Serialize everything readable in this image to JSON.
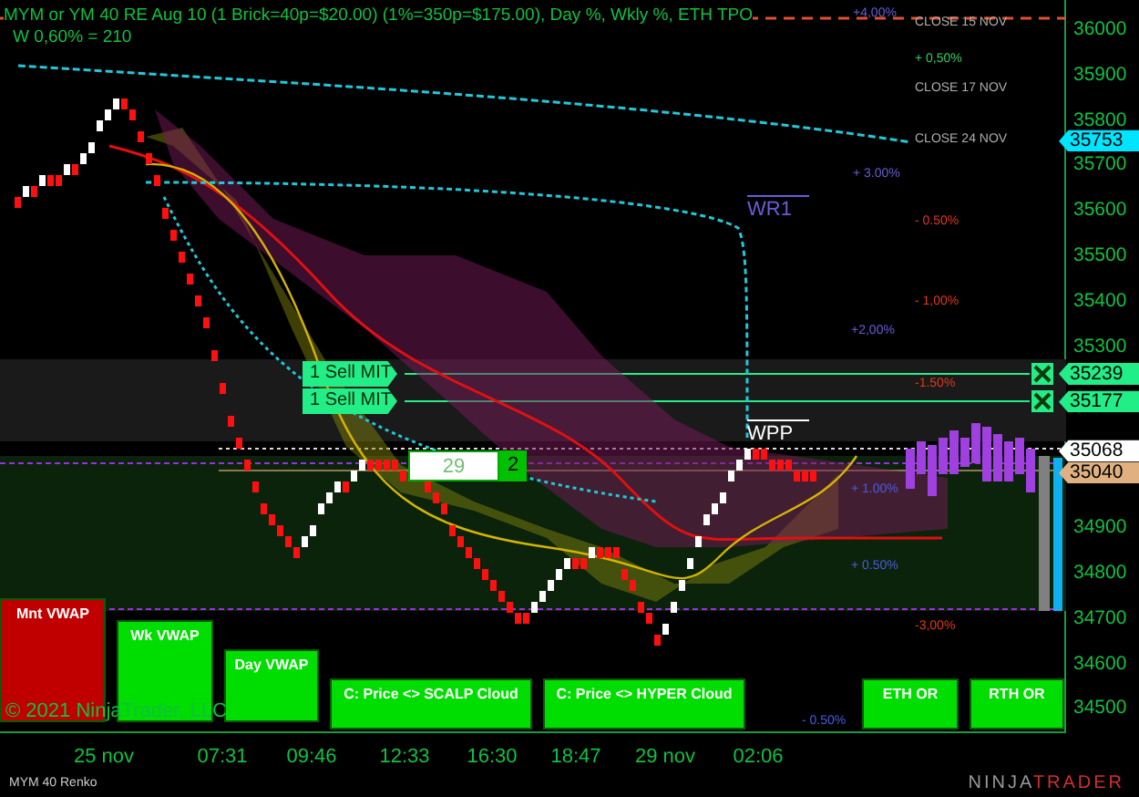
{
  "chart": {
    "title": "MYM or YM 40 RE Aug 10 (1 Brick=40p=$20.00) (1%=350p=$175.00), Day %, Wkly %, ETH TPO",
    "subtitle": "W 0,60% = 210",
    "copyright": "© 2021 NinjaTrader, LLC",
    "instrument": "MYM 40 Renko",
    "logo": [
      "NINJA",
      "TRADER"
    ]
  },
  "level_labels": [
    {
      "text": "+4,00%",
      "color": "#6a5cd8"
    },
    {
      "text": "CLOSE 15 NOV",
      "color": "#b0b0b0"
    },
    {
      "text": "+ 0,50%",
      "color": "#30d060"
    },
    {
      "text": "CLOSE 17 NOV",
      "color": "#b0b0b0"
    },
    {
      "text": "CLOSE 24 NOV",
      "color": "#b0b0b0"
    },
    {
      "text": "+ 3.00%",
      "color": "#6a5cd8"
    },
    {
      "text": "- 0.50%",
      "color": "#e03a1a"
    },
    {
      "text": "- 1,00%",
      "color": "#e03a1a"
    },
    {
      "text": "+2,00%",
      "color": "#6a5cd8"
    },
    {
      "text": "-1.50%",
      "color": "#e03a1a"
    },
    {
      "text": "+ 1.00%",
      "color": "#4a5ce0"
    },
    {
      "text": "+ 0.50%",
      "color": "#4a5ce0"
    },
    {
      "text": "-3,00%",
      "color": "#e03a1a"
    },
    {
      "text": "- 0.50%",
      "color": "#4a5ce0"
    }
  ],
  "pivots": [
    {
      "label": "WR1",
      "kind": "resistance"
    },
    {
      "label": "WPP",
      "kind": "pivot"
    }
  ],
  "orders": [
    {
      "label": "1 Sell MIT"
    },
    {
      "label": "1 Sell MIT"
    }
  ],
  "order_ticket": {
    "price": "29",
    "quantity": "2"
  },
  "price_axis": {
    "ticks": [
      "36000",
      "35900",
      "35800",
      "35700",
      "35600",
      "35500",
      "35400",
      "35300",
      "34900",
      "34800",
      "34700",
      "34600",
      "34500"
    ]
  },
  "price_markers": [
    {
      "value": "35753",
      "color": "#00e5ff"
    },
    {
      "value": "35239",
      "color": "#22ee88"
    },
    {
      "value": "35177",
      "color": "#22ee88"
    },
    {
      "value": "35068",
      "color": "#ffffff"
    },
    {
      "value": "35040",
      "color": "#e0b080"
    }
  ],
  "time_axis": {
    "ticks": [
      "25 nov",
      "07:31",
      "09:46",
      "12:33",
      "16:30",
      "18:47",
      "29 nov",
      "02:06"
    ]
  },
  "signal_boxes": [
    {
      "label": "Mnt VWAP",
      "color": "#c00000"
    },
    {
      "label": "Wk VWAP",
      "color": "#00dd00"
    },
    {
      "label": "Day VWAP",
      "color": "#00dd00"
    },
    {
      "label": "C: Price <> SCALP Cloud",
      "color": "#00dd00"
    },
    {
      "label": "C: Price <> HYPER Cloud",
      "color": "#00dd00"
    },
    {
      "label": "ETH OR",
      "color": "#00dd00"
    },
    {
      "label": "RTH OR",
      "color": "#00dd00"
    }
  ]
}
